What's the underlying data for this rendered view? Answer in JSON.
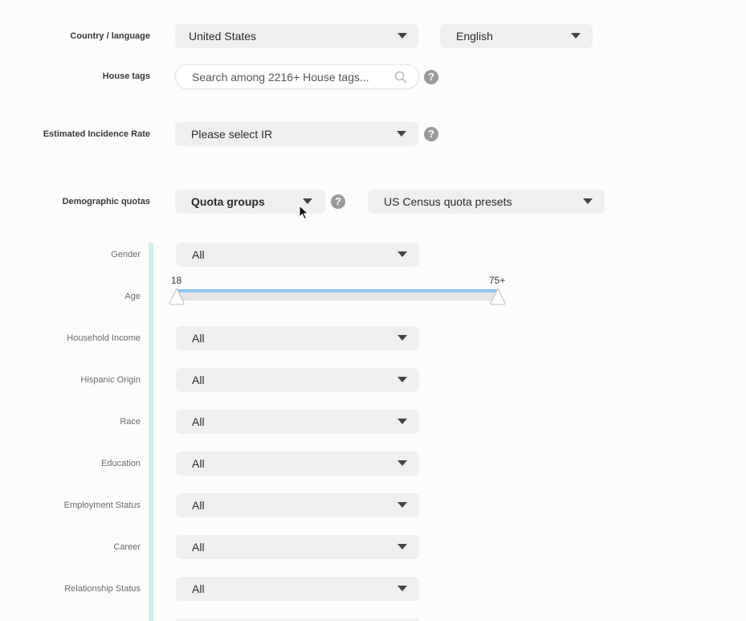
{
  "country_language": {
    "label": "Country / language",
    "country": "United States",
    "language": "English"
  },
  "house_tags": {
    "label": "House tags",
    "placeholder": "Search among 2216+ House tags...",
    "help": "?"
  },
  "incidence_rate": {
    "label": "Estimated Incidence Rate",
    "value": "Please select IR",
    "help": "?"
  },
  "demographic_quotas": {
    "label": "Demographic quotas",
    "quota_groups": "Quota groups",
    "help": "?",
    "presets": "US Census quota presets"
  },
  "quotas": {
    "gender": {
      "label": "Gender",
      "value": "All"
    },
    "age": {
      "label": "Age",
      "min": "18",
      "max": "75+"
    },
    "household_income": {
      "label": "Household Income",
      "value": "All"
    },
    "hispanic_origin": {
      "label": "Hispanic Origin",
      "value": "All"
    },
    "race": {
      "label": "Race",
      "value": "All"
    },
    "education": {
      "label": "Education",
      "value": "All"
    },
    "employment_status": {
      "label": "Employment Status",
      "value": "All"
    },
    "career": {
      "label": "Career",
      "value": "All"
    },
    "relationship_status": {
      "label": "Relationship Status",
      "value": "All"
    }
  },
  "colors": {
    "accent_bar": "#cdeeed",
    "slider_fill": "#8cc6ee"
  }
}
